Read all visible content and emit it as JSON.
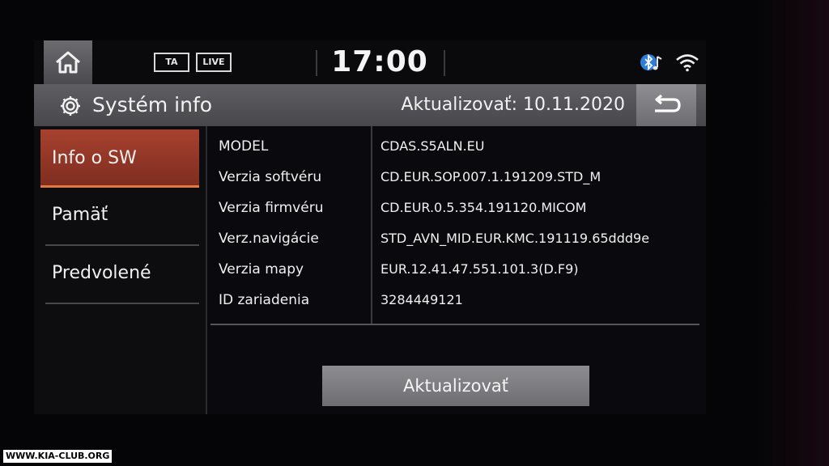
{
  "status_bar": {
    "ta_label": "TA",
    "live_label": "LIVE",
    "time": "17:00",
    "icons": [
      "home-icon",
      "bluetooth-audio-icon",
      "wifi-icon"
    ]
  },
  "title_bar": {
    "title": "Systém info",
    "update_date": "Aktualizovať: 10.11.2020",
    "icons": [
      "gear-icon",
      "back-arrow-icon"
    ]
  },
  "menu": {
    "items": [
      {
        "label": "Info o SW",
        "active": true
      },
      {
        "label": "Pamäť",
        "active": false
      },
      {
        "label": "Predvolené",
        "active": false
      }
    ]
  },
  "info": {
    "rows": [
      {
        "label": "MODEL",
        "value": "CDAS.S5ALN.EU"
      },
      {
        "label": "Verzia softvéru",
        "value": "CD.EUR.SOP.007.1.191209.STD_M"
      },
      {
        "label": "Verzia firmvéru",
        "value": "CD.EUR.0.5.354.191120.MICOM"
      },
      {
        "label": "Verz.navigácie",
        "value": "STD_AVN_MID.EUR.KMC.191119.65ddd9e"
      },
      {
        "label": "Verzia mapy",
        "value": "EUR.12.41.47.551.101.3(D.F9)"
      },
      {
        "label": "ID zariadenia",
        "value": "3284449121"
      }
    ]
  },
  "update_button": "Aktualizovať",
  "watermark": "WWW.KIA-CLUB.ORG",
  "colors": {
    "active_menu": "#a8412f",
    "title_bar": "#55555a",
    "button": "#7d7d82"
  }
}
